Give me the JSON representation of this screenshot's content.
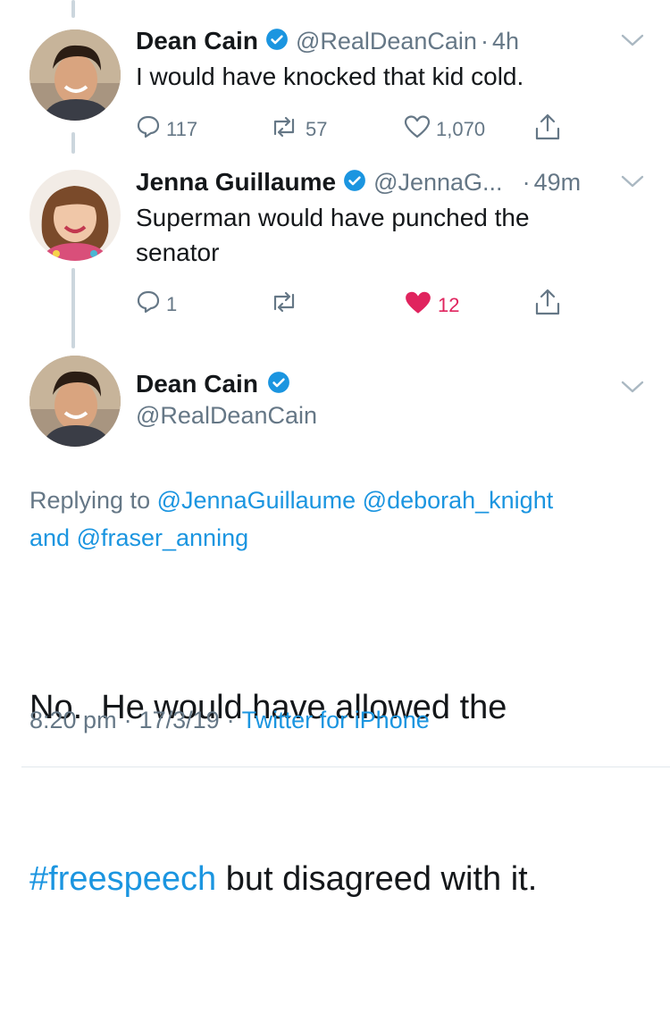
{
  "tweets": [
    {
      "name": "Dean Cain",
      "handle": "@RealDeanCain",
      "time": "4h",
      "text": "I would have knocked that kid cold.",
      "replies": "117",
      "retweets": "57",
      "likes": "1,070"
    },
    {
      "name": "Jenna Guillaume",
      "handle": "@JennaG...",
      "time": "49m",
      "text_line1": "Superman would have punched the",
      "text_line2": "senator",
      "replies": "1",
      "likes": "12"
    }
  ],
  "main": {
    "name": "Dean Cain",
    "handle": "@RealDeanCain",
    "replying_prefix": "Replying to",
    "reply_user1": "@JennaGuillaume",
    "reply_user2": "@deborah_knight",
    "reply_and": "and",
    "reply_user3": "@fraser_anning",
    "text_line1": "No.  He would have allowed the",
    "hashtag": "#freespeech",
    "text_rest": "but disagreed with it.",
    "time": "8:20 pm",
    "date": "17/3/19",
    "source": "Twitter for iPhone"
  },
  "separator": "·",
  "colors": {
    "accent": "#1b95e0",
    "like": "#e0245e",
    "muted": "#657786",
    "thread": "#ccd6dd"
  },
  "icons": [
    "verified-icon",
    "chevron-down-icon",
    "reply-icon",
    "retweet-icon",
    "heart-icon",
    "share-icon"
  ]
}
